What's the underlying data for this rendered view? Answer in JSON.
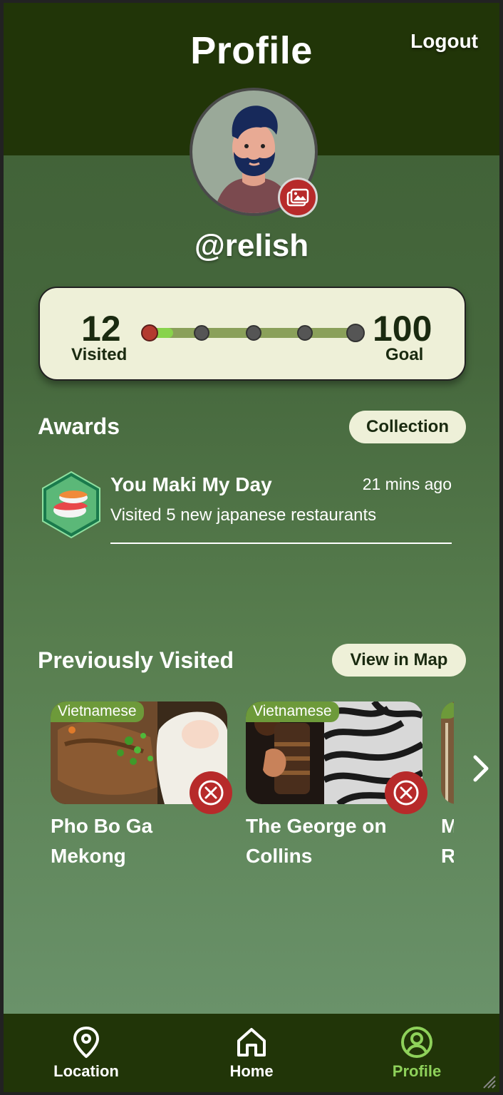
{
  "header": {
    "title": "Profile",
    "logout_label": "Logout"
  },
  "profile": {
    "username": "@relish"
  },
  "progress": {
    "visited_count": "12",
    "visited_label": "Visited",
    "goal_count": "100",
    "goal_label": "Goal",
    "fraction": 0.12
  },
  "awards": {
    "title": "Awards",
    "collection_label": "Collection",
    "items": [
      {
        "title": "You Maki My Day",
        "time": "21 mins ago",
        "description": "Visited 5 new japanese restaurants"
      }
    ]
  },
  "visited": {
    "title": "Previously Visited",
    "map_label": "View in Map",
    "items": [
      {
        "tag": "Vietnamese",
        "name": "Pho Bo Ga Mekong"
      },
      {
        "tag": "Vietnamese",
        "name": "The George on Collins"
      },
      {
        "tag": "",
        "name": "M R"
      }
    ]
  },
  "nav": {
    "items": [
      {
        "label": "Location"
      },
      {
        "label": "Home"
      },
      {
        "label": "Profile"
      }
    ]
  },
  "colors": {
    "header": "#213508",
    "accent": "#8ed15a",
    "danger": "#b72a2a",
    "card": "#eef0d8"
  },
  "icons": [
    "image-icon",
    "close-circle-icon",
    "chevron-right-icon",
    "location-pin-icon",
    "home-icon",
    "user-circle-icon"
  ]
}
